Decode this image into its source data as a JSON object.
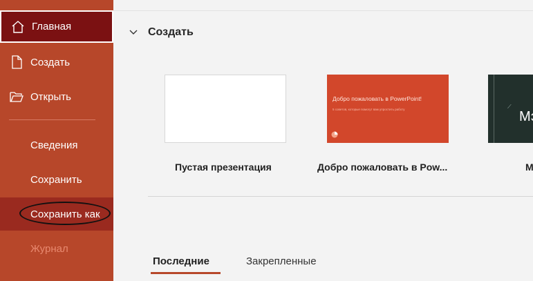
{
  "sidebar": {
    "home": "Главная",
    "new": "Создать",
    "open": "Открыть",
    "info": "Сведения",
    "save": "Сохранить",
    "save_as": "Сохранить как",
    "history": "Журнал"
  },
  "main": {
    "section_title": "Создать",
    "templates": [
      {
        "label": "Пустая презентация"
      },
      {
        "label": "Добро пожаловать в Pow...",
        "thumb_title": "Добро пожаловать в PowerPoint!",
        "thumb_subtitle": "5 советов, которые помогут вам упростить работу"
      },
      {
        "label": "М",
        "thumb_text": "Мэ"
      }
    ],
    "tabs": [
      {
        "label": "Последние",
        "active": true
      },
      {
        "label": "Закрепленные",
        "active": false
      }
    ]
  },
  "colors": {
    "accent": "#b7472a",
    "home_selected": "#7b1112",
    "welcome_tile": "#d2472b"
  }
}
